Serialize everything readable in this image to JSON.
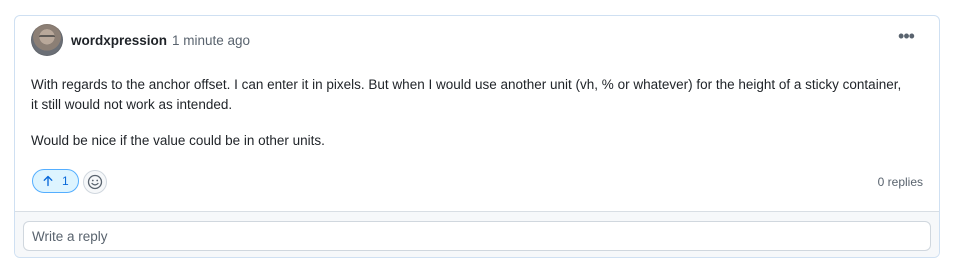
{
  "comment": {
    "author": "wordxpression",
    "timestamp": "1 minute ago",
    "more_icon": "kebab-horizontal-icon",
    "paragraphs": [
      "With regards to the anchor offset. I can enter it in pixels. But when I would use another unit (vh, % or whatever) for the height of a sticky container, it still would not work as intended.",
      "Would be nice if the value could be in other units."
    ],
    "upvote": {
      "icon": "arrow-up-icon",
      "count": "1"
    },
    "reaction_icon": "smiley-icon",
    "replies": "0 replies"
  },
  "reply": {
    "placeholder": "Write a reply"
  },
  "colors": {
    "accent": "#0969da",
    "upvote_bg": "#ddf4ff",
    "upvote_border": "#54aeff",
    "card_border": "#cfe0f2"
  }
}
